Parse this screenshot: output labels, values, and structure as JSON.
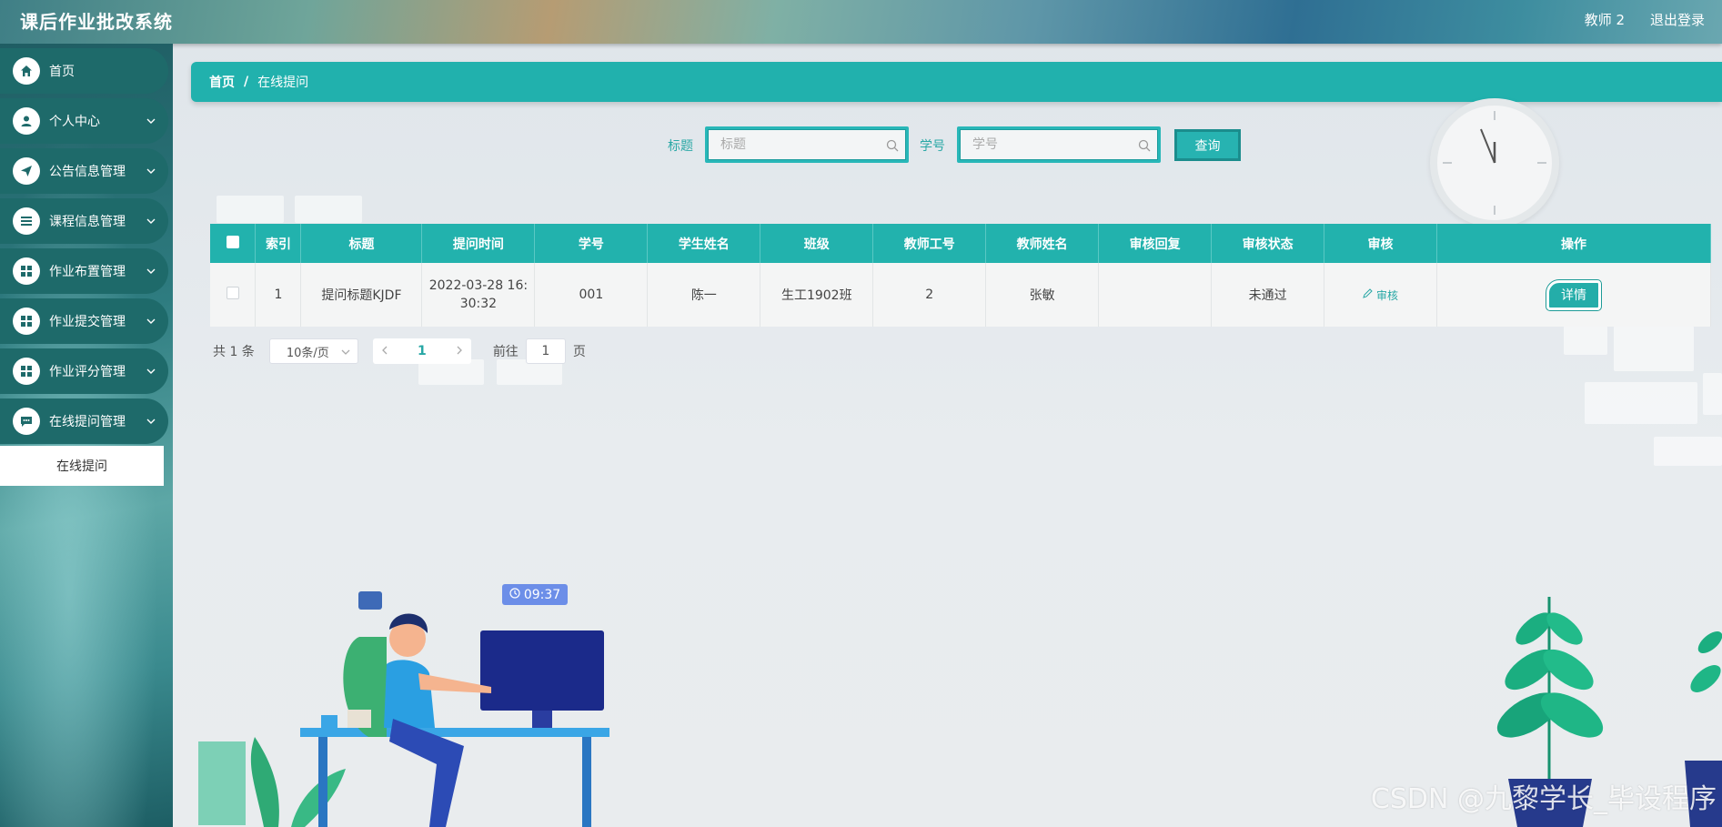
{
  "app": {
    "title": "课后作业批改系统",
    "user": "教师 2",
    "logout": "退出登录"
  },
  "sidebar": {
    "items": [
      {
        "label": "首页",
        "icon": "home-icon",
        "has_children": false
      },
      {
        "label": "个人中心",
        "icon": "user-icon",
        "has_children": true
      },
      {
        "label": "公告信息管理",
        "icon": "send-icon",
        "has_children": true
      },
      {
        "label": "课程信息管理",
        "icon": "list-icon",
        "has_children": true
      },
      {
        "label": "作业布置管理",
        "icon": "grid-icon",
        "has_children": true
      },
      {
        "label": "作业提交管理",
        "icon": "grid-icon",
        "has_children": true
      },
      {
        "label": "作业评分管理",
        "icon": "grid-icon",
        "has_children": true
      },
      {
        "label": "在线提问管理",
        "icon": "chat-icon",
        "has_children": true
      }
    ],
    "submenu": {
      "label": "在线提问"
    }
  },
  "breadcrumb": {
    "home": "首页",
    "separator": "/",
    "current": "在线提问"
  },
  "search": {
    "title_label": "标题",
    "title_placeholder": "标题",
    "student_label": "学号",
    "student_placeholder": "学号",
    "button": "查询"
  },
  "table": {
    "headers": [
      "索引",
      "标题",
      "提问时间",
      "学号",
      "学生姓名",
      "班级",
      "教师工号",
      "教师姓名",
      "审核回复",
      "审核状态",
      "审核",
      "操作"
    ],
    "rows": [
      {
        "index": "1",
        "title": "提问标题KJDF",
        "time_line1": "2022-03-28 16:",
        "time_line2": "30:32",
        "student_id": "001",
        "student_name": "陈一",
        "class": "生工1902班",
        "teacher_id": "2",
        "teacher_name": "张敏",
        "reply": "",
        "status": "未通过",
        "review": "审核",
        "action": "详情"
      }
    ]
  },
  "pagination": {
    "total": "共 1 条",
    "page_size": "10条/页",
    "current_page": "1",
    "goto_prefix": "前往",
    "goto_value": "1",
    "goto_suffix": "页"
  },
  "illustration": {
    "time": "09:37"
  },
  "watermark": "CSDN @九黎学长_毕设程序",
  "colors": {
    "accent": "#21b1ad",
    "sidebar": "#1e6a6a",
    "header_text": "#ffffff"
  }
}
